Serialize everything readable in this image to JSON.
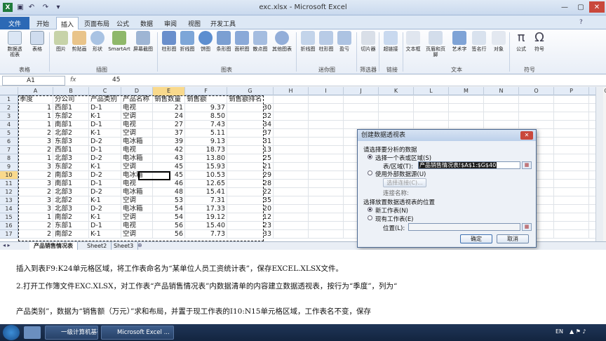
{
  "window": {
    "title": "exc.xlsx - Microsoft Excel"
  },
  "tabs": [
    {
      "label": "文件"
    },
    {
      "label": "开始"
    },
    {
      "label": "插入"
    },
    {
      "label": "页面布局"
    },
    {
      "label": "公式"
    },
    {
      "label": "数据"
    },
    {
      "label": "审阅"
    },
    {
      "label": "视图"
    },
    {
      "label": "开发工具"
    }
  ],
  "ribbon": {
    "buttons": [
      "数据透视表",
      "表格",
      "图片",
      "剪贴画",
      "形状",
      "SmartArt",
      "屏幕截图",
      "柱形图",
      "折线图",
      "饼图",
      "条形图",
      "面积图",
      "散点图",
      "其他图表",
      "折线图",
      "柱形图",
      "盈亏",
      "切片器",
      "超链接",
      "文本框",
      "页眉和页脚",
      "艺术字",
      "签名行",
      "对象",
      "公式",
      "符号"
    ],
    "groups": [
      "表格",
      "插图",
      "图表",
      "迷你图",
      "筛选器",
      "链接",
      "文本",
      "符号"
    ]
  },
  "formula_bar": {
    "name_box": "A1",
    "fx": "fx",
    "value": "45"
  },
  "columns": [
    "A",
    "B",
    "C",
    "D",
    "E",
    "F",
    "G",
    "H",
    "I",
    "J",
    "K",
    "L",
    "M",
    "N",
    "O",
    "P",
    "Q"
  ],
  "rows": [
    [
      "季度",
      "分公司",
      "产品类别",
      "产品名称",
      "销售数量",
      "销售额",
      "销售额排名"
    ],
    [
      "1",
      "西部1",
      "D-1",
      "电视",
      "21",
      "9.37",
      "30"
    ],
    [
      "1",
      "东部2",
      "K-1",
      "空调",
      "24",
      "8.50",
      "32"
    ],
    [
      "1",
      "南部1",
      "D-1",
      "电视",
      "27",
      "7.43",
      "34"
    ],
    [
      "2",
      "北部2",
      "K-1",
      "空调",
      "37",
      "5.11",
      "37"
    ],
    [
      "3",
      "东部3",
      "D-2",
      "电冰箱",
      "39",
      "9.13",
      "31"
    ],
    [
      "2",
      "西部1",
      "D-1",
      "电视",
      "42",
      "18.73",
      "13"
    ],
    [
      "1",
      "北部3",
      "D-2",
      "电冰箱",
      "43",
      "13.80",
      "25"
    ],
    [
      "3",
      "东部2",
      "K-1",
      "空调",
      "45",
      "15.93",
      "21"
    ],
    [
      "2",
      "南部3",
      "D-2",
      "电冰箱",
      "45",
      "10.53",
      "29"
    ],
    [
      "3",
      "南部1",
      "D-1",
      "电视",
      "46",
      "12.65",
      "28"
    ],
    [
      "2",
      "北部3",
      "D-2",
      "电冰箱",
      "48",
      "15.41",
      "22"
    ],
    [
      "3",
      "北部2",
      "K-1",
      "空调",
      "53",
      "7.31",
      "35"
    ],
    [
      "3",
      "北部3",
      "D-2",
      "电冰箱",
      "54",
      "17.33",
      "20"
    ],
    [
      "1",
      "南部2",
      "K-1",
      "空调",
      "54",
      "19.12",
      "12"
    ],
    [
      "2",
      "东部1",
      "D-1",
      "电视",
      "56",
      "15.40",
      "23"
    ],
    [
      "2",
      "南部2",
      "K-1",
      "空调",
      "56",
      "7.73",
      "33"
    ]
  ],
  "row_numbers": [
    "1",
    "2",
    "3",
    "4",
    "5",
    "6",
    "7",
    "8",
    "9",
    "10",
    "11",
    "12",
    "13",
    "14",
    "15",
    "16",
    "17"
  ],
  "sheets": [
    "产品销售情况表",
    "Sheet2",
    "Sheet3"
  ],
  "dialog": {
    "title": "创建数据透视表",
    "close": "✕",
    "section1": "请选择要分析的数据",
    "opt_table": "选择一个表或区域(S)",
    "table_label": "表/区域(T):",
    "table_value": "产品销售情况表!$A$1:$G$40",
    "opt_external": "使用外部数据源(U)",
    "choose_conn": "选择连接(C)...",
    "conn_name": "连接名称:",
    "section2": "选择放置数据透视表的位置",
    "opt_new": "新工作表(N)",
    "opt_existing": "现有工作表(E)",
    "location_label": "位置(L):",
    "ok": "确定",
    "cancel": "取消"
  },
  "subtitles": [
    "插入到表F9:K24单元格区域，将工作表命名为“某单位人员工资统计表”，保存EXCEL.XLSX文件。",
    "2.打开工作簿文件EXC.XLSX，对工作表“产品销售情况表”内数据清单的内容建立数据透视表，按行为“季度”，列为“",
    "产品类别”，数据为“销售额（万元）”求和布局，并置于现工作表的I10:N15单元格区域，工作表名不变，保存"
  ],
  "taskbar": {
    "items": [
      "一级计算机基础...",
      "Microsoft Excel ..."
    ],
    "lang": "EN"
  }
}
